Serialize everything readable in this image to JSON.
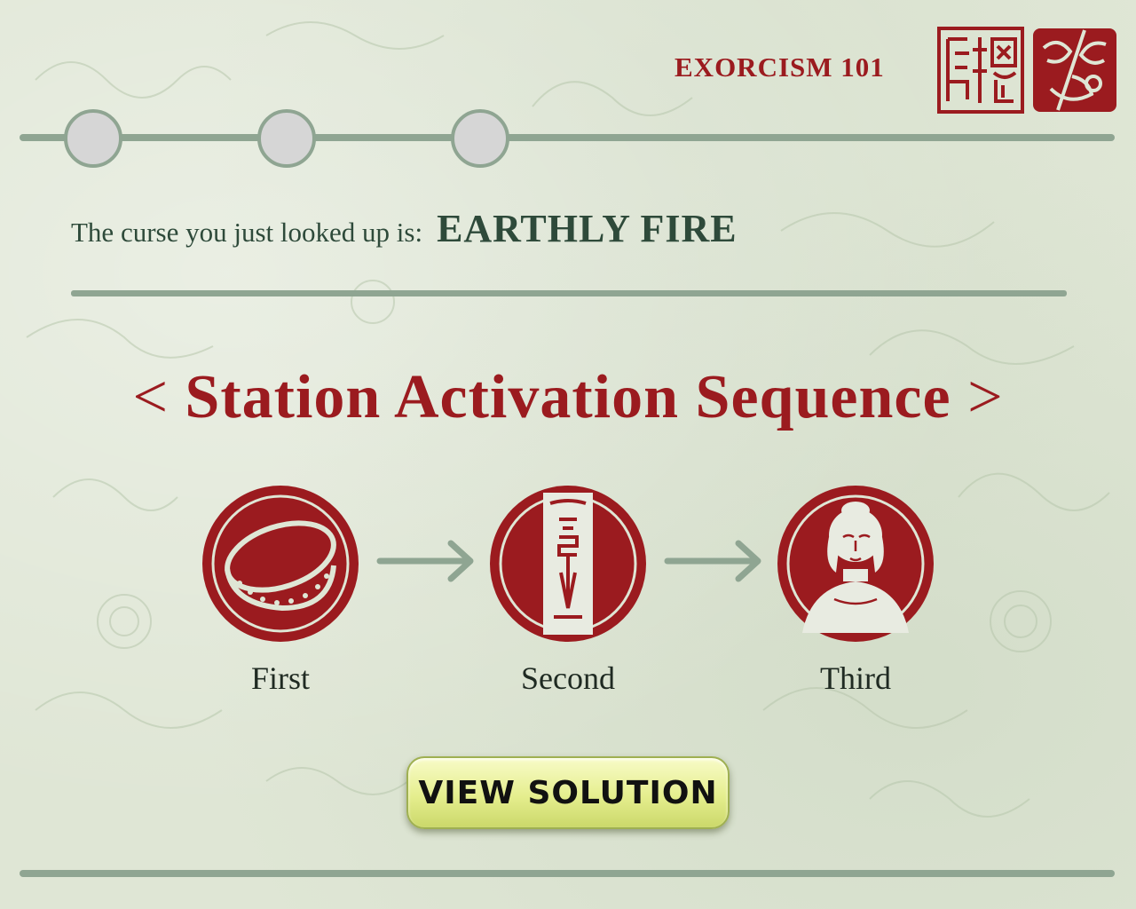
{
  "header": {
    "title": "EXORCISM 101"
  },
  "progress": {
    "total_steps": 3
  },
  "curse": {
    "label": "The curse you just looked up is:",
    "name": "EARTHLY FIRE"
  },
  "sequence": {
    "bracket_left": "<",
    "title": "Station Activation Sequence",
    "bracket_right": ">",
    "stations": [
      {
        "label": "First",
        "icon": "drum-icon"
      },
      {
        "label": "Second",
        "icon": "talisman-scroll-icon"
      },
      {
        "label": "Third",
        "icon": "buddha-icon"
      }
    ]
  },
  "actions": {
    "view_solution": "VIEW SOLUTION"
  },
  "colors": {
    "background": "#dfe6d5",
    "accent_red": "#9b1b1f",
    "dark_green": "#2e4a3a",
    "line_green": "#8fa592",
    "button_yellow": "#e5ee8e"
  }
}
